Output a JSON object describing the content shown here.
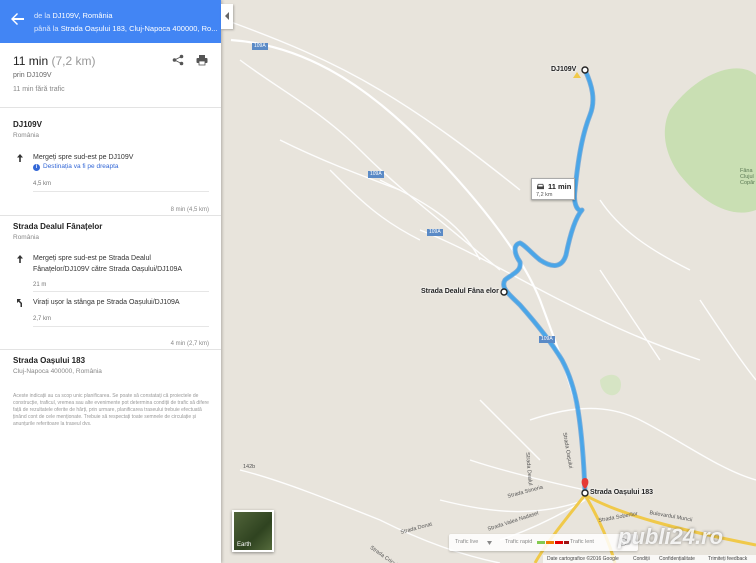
{
  "header": {
    "from_prefix": "de la",
    "from_value": "DJ109V, România",
    "to_prefix": "până la",
    "to_value": "Strada Oașului 183, Cluj-Napoca 400000, Ro..."
  },
  "summary": {
    "time": "11 min",
    "distance": "(7,2 km)",
    "via": "prin DJ109V",
    "traffic": "11 min fără trafic"
  },
  "sections": [
    {
      "title": "DJ109V",
      "subtitle": "România",
      "steps": [
        {
          "icon": "arrow-up-icon",
          "text": "Mergeți spre sud-est pe DJ109V",
          "note": "Destinația va fi pe dreapta",
          "distance": "4,5 km"
        }
      ],
      "total": "8 min (4,5 km)"
    },
    {
      "title": "Strada Dealul Fânațelor",
      "subtitle": "România",
      "steps": [
        {
          "icon": "arrow-up-icon",
          "text": "Mergeți spre sud-est pe Strada Dealul Fânațelor/DJ109V către Strada Oașului/DJ109A",
          "distance": "21 m"
        },
        {
          "icon": "turn-slight-left-icon",
          "text": "Virați ușor la stânga pe Strada Oașului/DJ109A",
          "distance": "2,7 km"
        }
      ],
      "total": "4 min (2,7 km)"
    },
    {
      "title": "Strada Oașului 183",
      "subtitle": "Cluj-Napoca 400000, România"
    }
  ],
  "disclaimer": "Aceste indicații au ca scop unic planificarea. Se poate să constatați că proiectele de construcție, traficul, vremea sau alte evenimente pot determina condiții de trafic să difere față de rezultatele oferite de hărți, prin urmare, planificarea traseului trebuie efectuată ținând cont de cele menționate. Trebuie să respectați toate semnele de circulație și anunțurile referitoare la traseul dvs.",
  "map": {
    "start_label": "DJ109V",
    "mid_label": "Strada Dealul Fâna elor",
    "end_label": "Strada Oașului 183",
    "route_box": {
      "time": "11 min",
      "distance": "7,2 km"
    },
    "road_badges": [
      "109A",
      "109A",
      "109A",
      "109A"
    ],
    "streets": [
      "142b",
      "Strada Oașului",
      "Strada Dealul",
      "Strada Simeria",
      "Strada Valea Nadasel",
      "Strada Donat",
      "Strada Cricului",
      "Bulevardul Muncii",
      "Strada Soberilor"
    ],
    "region_label": "Fâna Clujul Copăr",
    "earth_label": "Earth",
    "traffic": {
      "label": "Trafic live",
      "fast": "Trafic rapid",
      "slow": "Trafic lent"
    },
    "footer": {
      "data": "Date cartografice ©2016 Google",
      "terms": "Condiții",
      "privacy": "Confidențialitate",
      "feedback": "Trimiteți feedback"
    },
    "watermark": "publi24.ro"
  },
  "colors": {
    "header": "#4285f4",
    "route": "#4aa6e8",
    "park": "#c9dfb3",
    "road": "#ffffff"
  }
}
